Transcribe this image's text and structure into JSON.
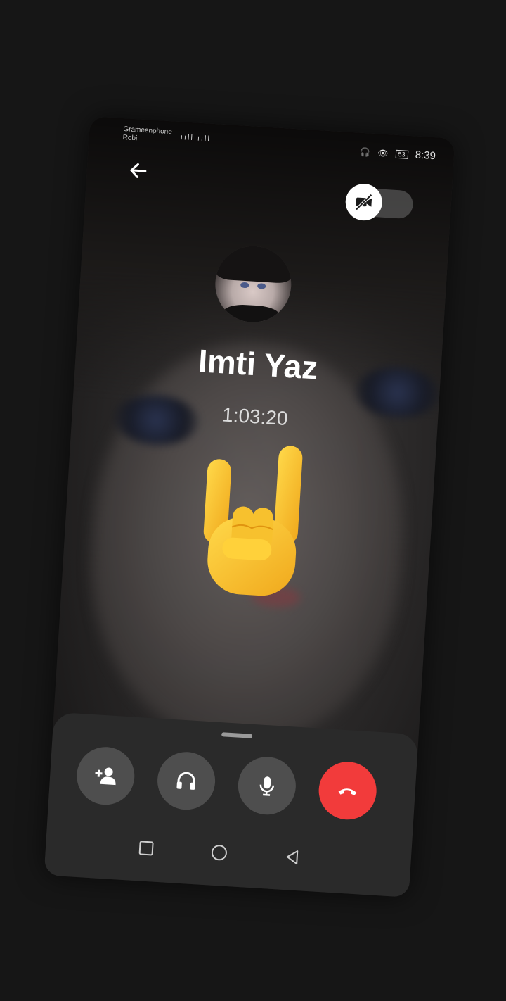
{
  "status_bar": {
    "carrier_1": "Grameenphone",
    "carrier_2": "Robi",
    "signal": "ııll ııll",
    "battery": "53",
    "time": "8:39"
  },
  "call": {
    "caller_name": "Imti Yaz",
    "duration": "1:03:20",
    "reaction": "🤘"
  },
  "icons": {
    "back": "arrow-left-icon",
    "camera_off": "video-off-icon",
    "add_person": "add-person-icon",
    "audio": "headphones-icon",
    "mic": "microphone-icon",
    "end_call": "phone-hangup-icon"
  },
  "colors": {
    "end_call": "#f23b3b",
    "control_bg": "#4e4e4e",
    "sheet_bg": "#2a2a2a"
  }
}
